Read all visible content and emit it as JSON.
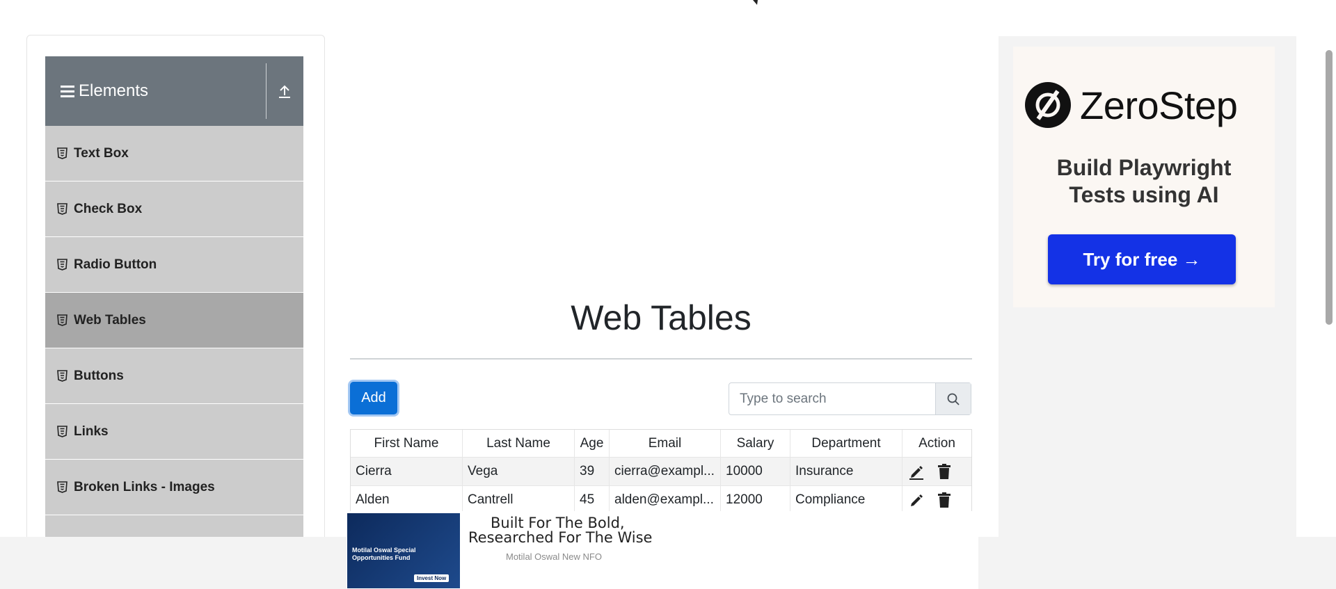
{
  "sidebar": {
    "group_title": "Elements",
    "items": [
      {
        "label": "Text Box",
        "active": false
      },
      {
        "label": "Check Box",
        "active": false
      },
      {
        "label": "Radio Button",
        "active": false
      },
      {
        "label": "Web Tables",
        "active": true
      },
      {
        "label": "Buttons",
        "active": false
      },
      {
        "label": "Links",
        "active": false
      },
      {
        "label": "Broken Links - Images",
        "active": false
      }
    ]
  },
  "main": {
    "title": "Web Tables",
    "add_label": "Add",
    "search_placeholder": "Type to search",
    "table": {
      "headers": [
        "First Name",
        "Last Name",
        "Age",
        "Email",
        "Salary",
        "Department",
        "Action"
      ],
      "rows": [
        [
          "Cierra",
          "Vega",
          "39",
          "cierra@exampl...",
          "10000",
          "Insurance"
        ],
        [
          "Alden",
          "Cantrell",
          "45",
          "alden@exampl...",
          "12000",
          "Compliance"
        ]
      ]
    }
  },
  "right_ad": {
    "brand": "ZeroStep",
    "tagline_line1": "Build Playwright",
    "tagline_line2": "Tests using AI",
    "cta": "Try for free →"
  },
  "bottom_ad": {
    "headline_line1": "Built For The Bold,",
    "headline_line2": "Researched For The Wise",
    "source": "Motilal Oswal New NFO",
    "thumb_text": "Motilal Oswal Special Opportunities Fund",
    "thumb_cta": "Invest Now"
  },
  "colors": {
    "sidebar_header": "#6c757d",
    "menu_item": "#cccccc",
    "menu_item_active": "#a8a8a8",
    "primary_button": "#0b6fd6",
    "cta_blue": "#1432e6"
  }
}
